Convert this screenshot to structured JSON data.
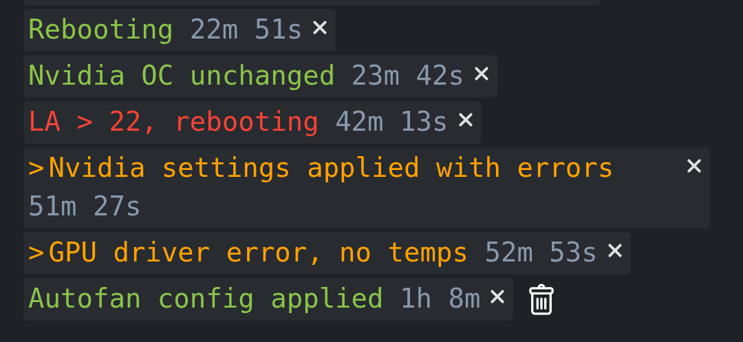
{
  "messages": [
    {
      "kind": "success",
      "text": "Rebooting",
      "time": "22m 51s"
    },
    {
      "kind": "success",
      "text": "Nvidia OC unchanged",
      "time": "23m 42s"
    },
    {
      "kind": "error",
      "text": "LA > 22, rebooting",
      "time": "42m 13s"
    },
    {
      "kind": "warning",
      "prefix": ">",
      "text": "Nvidia settings applied with errors",
      "time": "51m 27s"
    },
    {
      "kind": "warning",
      "prefix": ">",
      "text": "GPU driver error, no temps",
      "time": "52m 53s"
    },
    {
      "kind": "success",
      "text": "Autofan config applied",
      "time": "1h 8m"
    }
  ]
}
